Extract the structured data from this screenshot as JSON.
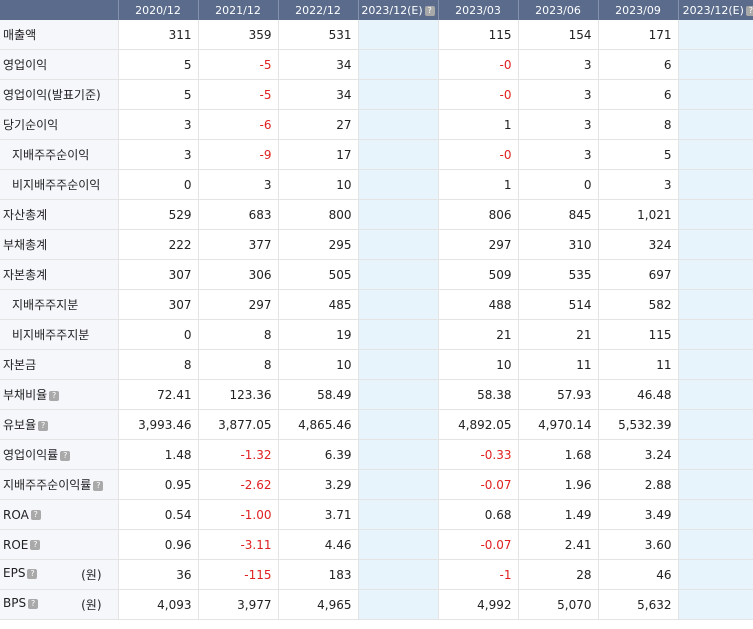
{
  "columns": [
    "2020/12",
    "2021/12",
    "2022/12",
    "2023/12(E)",
    "2023/03",
    "2023/06",
    "2023/09",
    "2023/12(E)"
  ],
  "estimate_columns": [
    3,
    7
  ],
  "help_icon": "?",
  "rows": [
    {
      "label": "매출액",
      "values": [
        "311",
        "359",
        "531",
        "",
        "115",
        "154",
        "171",
        ""
      ]
    },
    {
      "label": "영업이익",
      "values": [
        "5",
        "-5",
        "34",
        "",
        "-0",
        "3",
        "6",
        ""
      ]
    },
    {
      "label": "영업이익(발표기준)",
      "values": [
        "5",
        "-5",
        "34",
        "",
        "-0",
        "3",
        "6",
        ""
      ]
    },
    {
      "label": "당기순이익",
      "values": [
        "3",
        "-6",
        "27",
        "",
        "1",
        "3",
        "8",
        ""
      ]
    },
    {
      "label": "지배주주순이익",
      "sub": true,
      "values": [
        "3",
        "-9",
        "17",
        "",
        "-0",
        "3",
        "5",
        ""
      ]
    },
    {
      "label": "비지배주주순이익",
      "sub": true,
      "values": [
        "0",
        "3",
        "10",
        "",
        "1",
        "0",
        "3",
        ""
      ]
    },
    {
      "label": "자산총계",
      "values": [
        "529",
        "683",
        "800",
        "",
        "806",
        "845",
        "1,021",
        ""
      ]
    },
    {
      "label": "부채총계",
      "values": [
        "222",
        "377",
        "295",
        "",
        "297",
        "310",
        "324",
        ""
      ]
    },
    {
      "label": "자본총계",
      "values": [
        "307",
        "306",
        "505",
        "",
        "509",
        "535",
        "697",
        ""
      ]
    },
    {
      "label": "지배주주지분",
      "sub": true,
      "values": [
        "307",
        "297",
        "485",
        "",
        "488",
        "514",
        "582",
        ""
      ]
    },
    {
      "label": "비지배주주지분",
      "sub": true,
      "values": [
        "0",
        "8",
        "19",
        "",
        "21",
        "21",
        "115",
        ""
      ]
    },
    {
      "label": "자본금",
      "values": [
        "8",
        "8",
        "10",
        "",
        "10",
        "11",
        "11",
        ""
      ]
    },
    {
      "label": "부채비율",
      "help": true,
      "values": [
        "72.41",
        "123.36",
        "58.49",
        "",
        "58.38",
        "57.93",
        "46.48",
        ""
      ]
    },
    {
      "label": "유보율",
      "help": true,
      "values": [
        "3,993.46",
        "3,877.05",
        "4,865.46",
        "",
        "4,892.05",
        "4,970.14",
        "5,532.39",
        ""
      ]
    },
    {
      "label": "영업이익률",
      "help": true,
      "values": [
        "1.48",
        "-1.32",
        "6.39",
        "",
        "-0.33",
        "1.68",
        "3.24",
        ""
      ]
    },
    {
      "label": "지배주주순이익률",
      "help": true,
      "values": [
        "0.95",
        "-2.62",
        "3.29",
        "",
        "-0.07",
        "1.96",
        "2.88",
        ""
      ]
    },
    {
      "label": "ROA",
      "help": true,
      "values": [
        "0.54",
        "-1.00",
        "3.71",
        "",
        "0.68",
        "1.49",
        "3.49",
        ""
      ]
    },
    {
      "label": "ROE",
      "help": true,
      "values": [
        "0.96",
        "-3.11",
        "4.46",
        "",
        "-0.07",
        "2.41",
        "3.60",
        ""
      ]
    },
    {
      "label": "EPS",
      "help": true,
      "unit": "(원)",
      "values": [
        "36",
        "-115",
        "183",
        "",
        "-1",
        "28",
        "46",
        ""
      ]
    },
    {
      "label": "BPS",
      "help": true,
      "unit": "(원)",
      "values": [
        "4,093",
        "3,977",
        "4,965",
        "",
        "4,992",
        "5,070",
        "5,632",
        ""
      ]
    }
  ]
}
